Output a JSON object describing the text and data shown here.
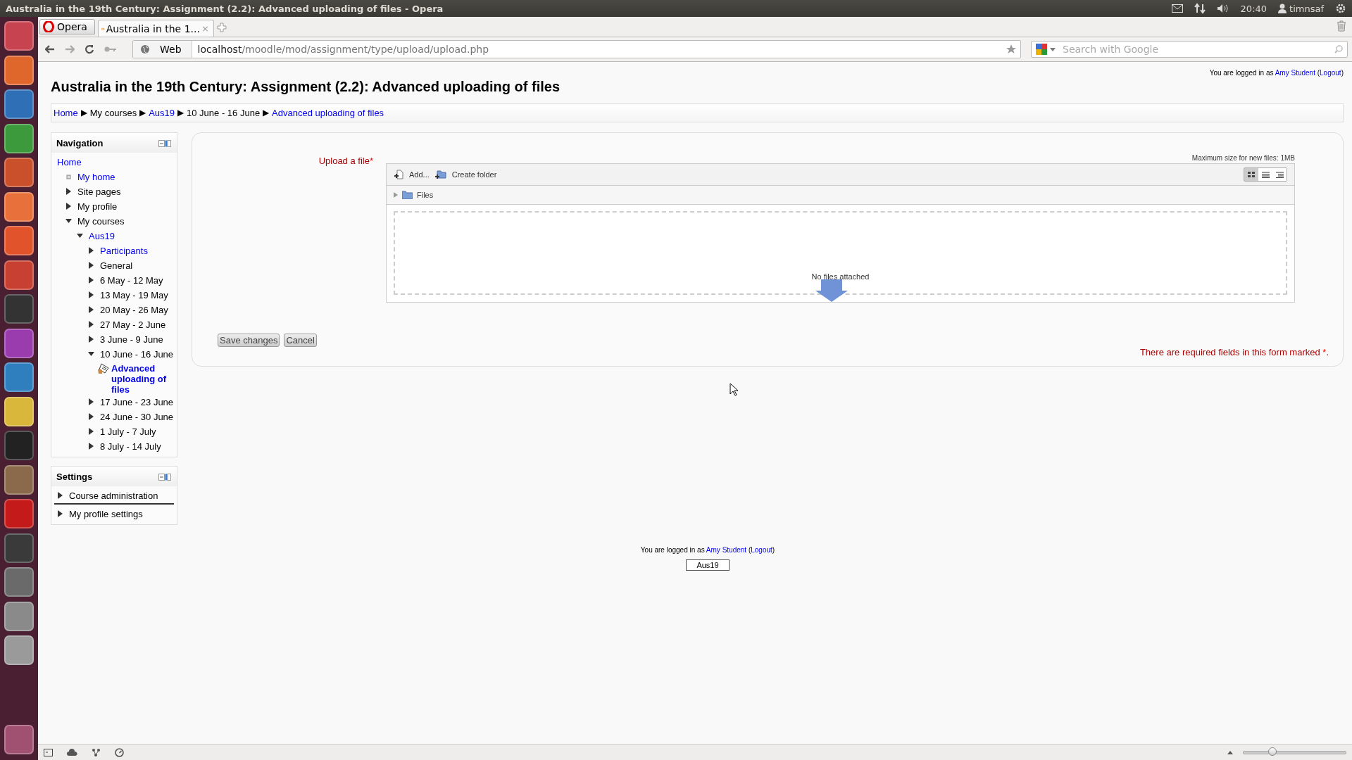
{
  "os_panel": {
    "window_title": "Australia in the 19th Century: Assignment (2.2): Advanced uploading of files - Opera",
    "clock": "20:40",
    "user": "timnsaf"
  },
  "browser": {
    "menu_button": "Opera",
    "tabs": [
      {
        "label": "Australia in the 1...",
        "close": "×",
        "selected": true
      }
    ],
    "web_label": "Web",
    "address": {
      "host": "localhost",
      "path": "/moodle/mod/assignment/type/upload/upload.php"
    },
    "search": {
      "placeholder": "Search with Google"
    },
    "zoom": {
      "level": 0.28
    }
  },
  "header": {
    "title": "Australia in the 19th Century: Assignment (2.2): Advanced uploading of files",
    "login": {
      "prefix": "You are logged in as",
      "user": "Amy Student",
      "paren_open": "(",
      "logout": "Logout",
      "paren_close": ")"
    }
  },
  "breadcrumb": [
    {
      "label": "Home",
      "link": true
    },
    {
      "label": "My courses",
      "link": false
    },
    {
      "label": "Aus19",
      "link": true
    },
    {
      "label": "10 June - 16 June",
      "link": false
    },
    {
      "label": "Advanced uploading of files",
      "link": true
    }
  ],
  "breadcrumb_separator": "▶",
  "navigation": {
    "title": "Navigation",
    "items": [
      {
        "label": "Home",
        "kind": "root",
        "link": true,
        "children": [
          {
            "label": "My home",
            "kind": "leaf",
            "link": true
          },
          {
            "label": "Site pages",
            "kind": "branch",
            "link": false,
            "expanded": false
          },
          {
            "label": "My profile",
            "kind": "branch",
            "link": false,
            "expanded": false
          },
          {
            "label": "My courses",
            "kind": "branch",
            "link": false,
            "expanded": true,
            "children": [
              {
                "label": "Aus19",
                "kind": "branch",
                "link": true,
                "expanded": true,
                "children": [
                  {
                    "label": "Participants",
                    "kind": "branch",
                    "link": true,
                    "expanded": false
                  },
                  {
                    "label": "General",
                    "kind": "branch",
                    "link": false,
                    "expanded": false
                  },
                  {
                    "label": "6 May - 12 May",
                    "kind": "branch",
                    "link": false,
                    "expanded": false
                  },
                  {
                    "label": "13 May - 19 May",
                    "kind": "branch",
                    "link": false,
                    "expanded": false
                  },
                  {
                    "label": "20 May - 26 May",
                    "kind": "branch",
                    "link": false,
                    "expanded": false
                  },
                  {
                    "label": "27 May - 2 June",
                    "kind": "branch",
                    "link": false,
                    "expanded": false
                  },
                  {
                    "label": "3 June - 9 June",
                    "kind": "branch",
                    "link": false,
                    "expanded": false
                  },
                  {
                    "label": "10 June - 16 June",
                    "kind": "branch",
                    "link": false,
                    "expanded": true,
                    "children": [
                      {
                        "label": "Advanced uploading of files",
                        "kind": "activity",
                        "link": true
                      }
                    ]
                  },
                  {
                    "label": "17 June - 23 June",
                    "kind": "branch",
                    "link": false,
                    "expanded": false
                  },
                  {
                    "label": "24 June - 30 June",
                    "kind": "branch",
                    "link": false,
                    "expanded": false
                  },
                  {
                    "label": "1 July - 7 July",
                    "kind": "branch",
                    "link": false,
                    "expanded": false
                  },
                  {
                    "label": "8 July - 14 July",
                    "kind": "branch",
                    "link": false,
                    "expanded": false
                  }
                ]
              }
            ]
          }
        ]
      }
    ]
  },
  "settings": {
    "title": "Settings",
    "items": [
      {
        "label": "Course administration",
        "kind": "branch",
        "link": false,
        "expanded": false
      },
      {
        "label": "My profile settings",
        "kind": "branch",
        "link": false,
        "expanded": false
      }
    ]
  },
  "form": {
    "label": "Upload a file",
    "required_mark": "*",
    "max_size": "Maximum size for new files: 1MB",
    "toolbar": [
      {
        "label": "Add...",
        "kind": "add"
      },
      {
        "label": "Create folder",
        "kind": "folder"
      }
    ],
    "views": [
      {
        "kind": "icons",
        "selected": true
      },
      {
        "kind": "list",
        "selected": false
      },
      {
        "kind": "tree",
        "selected": false
      }
    ],
    "path": "Files",
    "empty_message": "No files attached",
    "buttons": [
      "Save changes",
      "Cancel"
    ],
    "required_note": "There are required fields in this form marked",
    "required_note_mark": "*",
    "required_note_end": "."
  },
  "footer": {
    "login": {
      "prefix": "You are logged in as",
      "user": "Amy Student",
      "paren_open": "(",
      "logout": "Logout",
      "paren_close": ")"
    },
    "course_button": "Aus19"
  }
}
